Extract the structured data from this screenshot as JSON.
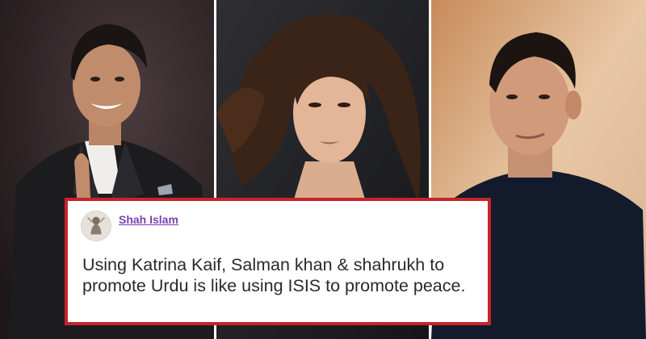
{
  "tweet": {
    "author": "Shah Islam",
    "text": "Using Katrina Kaif, Salman khan & shahrukh to promote Urdu is like using ISIS to promote peace."
  },
  "colors": {
    "card_border": "#c8232c",
    "author_link": "#7b3fb4",
    "text": "#2a2a2a"
  }
}
